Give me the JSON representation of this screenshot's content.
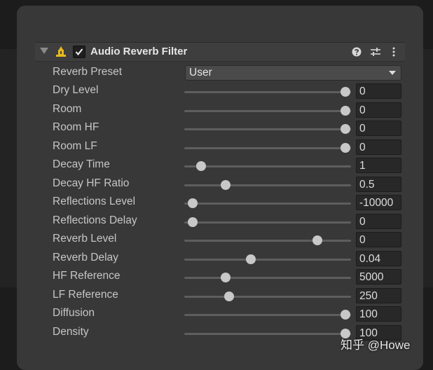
{
  "component": {
    "title": "Audio Reverb Filter",
    "enabled": true
  },
  "icons": {
    "fold": "triangle-down-icon",
    "component": "audio-filter-icon",
    "help": "question-circle-icon",
    "preset": "sliders-icon",
    "more": "kebab-menu-icon"
  },
  "reverb_preset": {
    "label": "Reverb Preset",
    "value": "User"
  },
  "properties": [
    {
      "label": "Dry Level",
      "value": "0",
      "slider": 1.0
    },
    {
      "label": "Room",
      "value": "0",
      "slider": 1.0
    },
    {
      "label": "Room HF",
      "value": "0",
      "slider": 1.0
    },
    {
      "label": "Room LF",
      "value": "0",
      "slider": 1.0
    },
    {
      "label": "Decay Time",
      "value": "1",
      "slider": 0.07
    },
    {
      "label": "Decay HF Ratio",
      "value": "0.5",
      "slider": 0.23
    },
    {
      "label": "Reflections Level",
      "value": "-10000",
      "slider": 0.02
    },
    {
      "label": "Reflections Delay",
      "value": "0",
      "slider": 0.02
    },
    {
      "label": "Reverb Level",
      "value": "0",
      "slider": 0.82
    },
    {
      "label": "Reverb Delay",
      "value": "0.04",
      "slider": 0.39
    },
    {
      "label": "HF Reference",
      "value": "5000",
      "slider": 0.23
    },
    {
      "label": "LF Reference",
      "value": "250",
      "slider": 0.25
    },
    {
      "label": "Diffusion",
      "value": "100",
      "slider": 1.0
    },
    {
      "label": "Density",
      "value": "100",
      "slider": 1.0
    }
  ],
  "watermark": "知乎 @Howe",
  "colors": {
    "panel": "#383838",
    "header": "#3e3e3e",
    "field": "#282828",
    "knob": "#c8c8c8",
    "track": "#5e5e5e"
  }
}
